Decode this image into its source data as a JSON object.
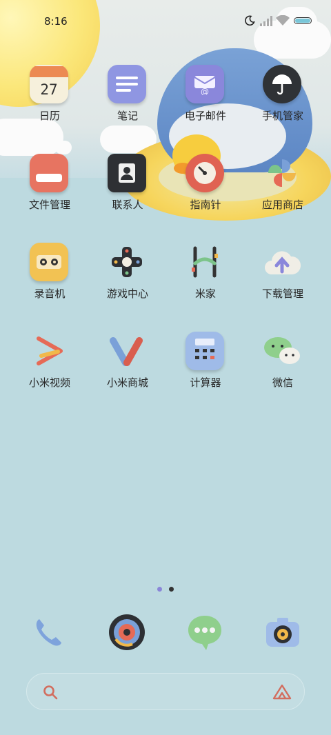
{
  "status_bar": {
    "time": "8:16",
    "icons": [
      "moon-icon",
      "signal-icon",
      "wifi-icon",
      "battery-icon"
    ]
  },
  "home_screen": {
    "rows": [
      [
        {
          "label": "日历",
          "icon": "calendar-icon",
          "date": "27"
        },
        {
          "label": "笔记",
          "icon": "notes-icon"
        },
        {
          "label": "电子邮件",
          "icon": "email-icon"
        },
        {
          "label": "手机管家",
          "icon": "security-umbrella-icon"
        }
      ],
      [
        {
          "label": "文件管理",
          "icon": "folder-icon"
        },
        {
          "label": "联系人",
          "icon": "contacts-icon"
        },
        {
          "label": "指南针",
          "icon": "compass-icon"
        },
        {
          "label": "应用商店",
          "icon": "pinwheel-icon"
        }
      ],
      [
        {
          "label": "录音机",
          "icon": "cassette-icon"
        },
        {
          "label": "游戏中心",
          "icon": "gamepad-icon"
        },
        {
          "label": "米家",
          "icon": "mijia-icon"
        },
        {
          "label": "下载管理",
          "icon": "cloud-download-icon"
        }
      ],
      [
        {
          "label": "小米视频",
          "icon": "video-play-icon"
        },
        {
          "label": "小米商城",
          "icon": "mi-store-icon"
        },
        {
          "label": "计算器",
          "icon": "calculator-icon"
        },
        {
          "label": "微信",
          "icon": "wechat-icon"
        }
      ]
    ]
  },
  "page_indicator": {
    "pages": 2,
    "active": 0,
    "active_color": "#8a86d8",
    "inactive_color": "#333333"
  },
  "dock": [
    {
      "name": "phone",
      "icon": "phone-icon"
    },
    {
      "name": "browser",
      "icon": "browser-lens-icon"
    },
    {
      "name": "messages",
      "icon": "message-bubble-icon"
    },
    {
      "name": "camera",
      "icon": "camera-icon"
    }
  ],
  "search_bar": {
    "left_icon": "search-icon",
    "right_icon": "xiaoai-assistant-icon"
  },
  "colors": {
    "sky": "#e8ecea",
    "sea": "#bddae0",
    "sun": "#fbe77a",
    "text": "#262626"
  }
}
